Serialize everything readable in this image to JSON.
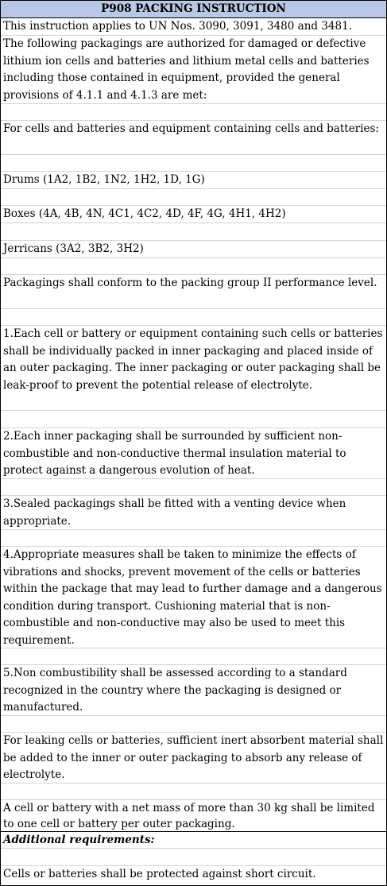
{
  "title": "P908 PACKING INSTRUCTION",
  "rows": [
    "This instruction applies to UN Nos. 3090, 3091, 3480 and 3481.",
    "The following packagings are authorized for damaged or defective lithium ion cells and batteries and lithium metal cells and batteries including those contained in equipment, provided the general provisions of 4.1.1 and 4.1.3 are met:",
    "For cells and batteries and equipment containing cells and batteries:",
    "Drums (1A2, 1B2, 1N2, 1H2, 1D, 1G)",
    "Boxes (4A, 4B, 4N, 4C1, 4C2, 4D, 4F, 4G, 4H1, 4H2)",
    "Jerricans (3A2, 3B2, 3H2)",
    "Packagings shall conform to the packing group II performance level.",
    "1.Each cell or battery or equipment containing such cells or batteries shall be individually packed in inner packaging and placed inside of an outer packaging. The inner packaging or outer packaging shall be leak-proof to prevent the potential release of electrolyte.",
    "2.Each inner packaging shall be surrounded by sufficient non-combustible and non-conductive thermal insulation material to protect against a dangerous evolution of heat.",
    "3.Sealed packagings shall be fitted with a venting device when appropriate.",
    "4.Appropriate measures shall be taken to minimize the effects of vibrations and shocks, prevent movement of the cells or batteries within the package that may lead to further damage and a dangerous condition during transport. Cushioning material that is non-combustible and non-conductive may also be used to meet this requirement.",
    "5.Non combustibility shall be assessed according to a standard recognized in the country where the packaging is designed or manufactured.",
    "For leaking cells or batteries, sufficient inert absorbent material shall be added to the inner or outer packaging to absorb any release of electrolyte.",
    "A cell or battery with a net mass of more than 30 kg shall be limited to one cell or battery per outer packaging.",
    "Additional requirements:",
    "Cells or batteries shall be protected against short circuit."
  ]
}
